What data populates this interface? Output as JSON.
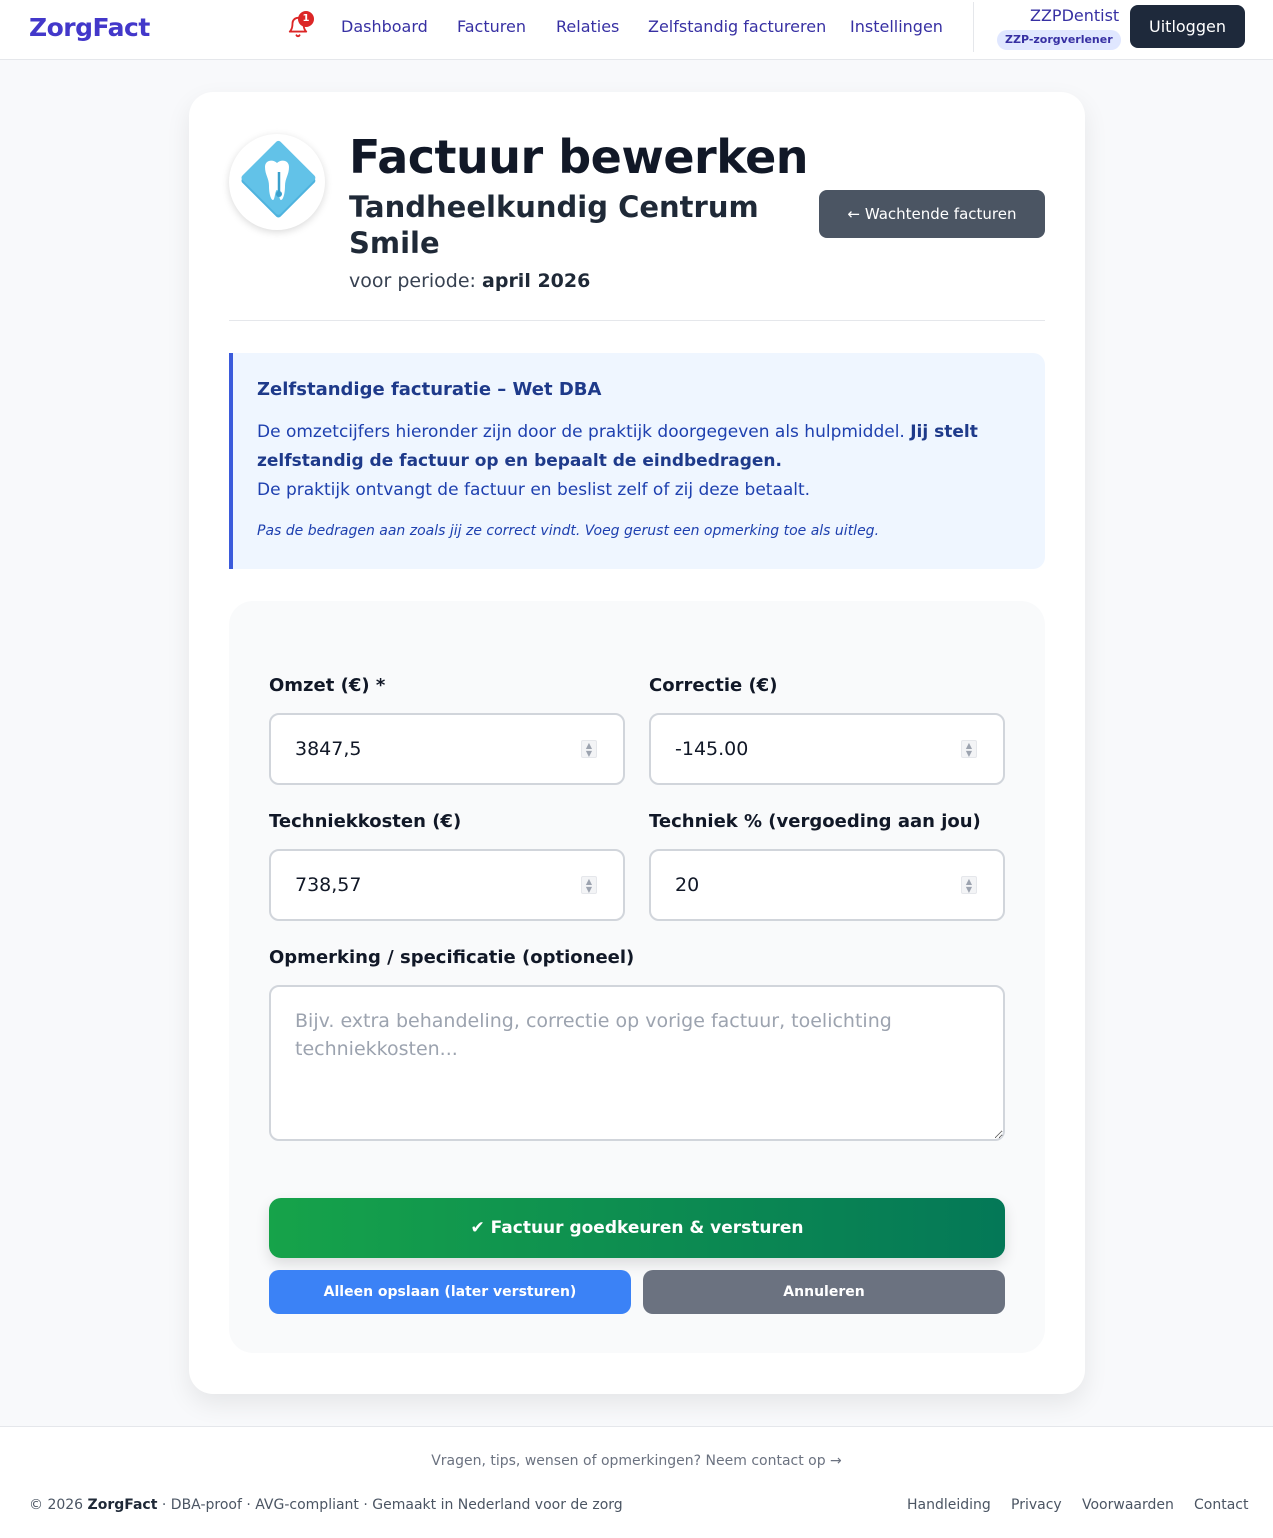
{
  "app": {
    "brand": "ZorgFact",
    "notification_count": "1"
  },
  "nav": {
    "items": [
      {
        "label": "Dashboard"
      },
      {
        "label": "Facturen"
      },
      {
        "label": "Relaties"
      },
      {
        "label": "Zelfstandig factureren"
      },
      {
        "label": "Instellingen"
      }
    ]
  },
  "user": {
    "name": "ZZPDentist",
    "role": "ZZP-zorgverlener",
    "logout_label": "Uitloggen"
  },
  "header": {
    "title": "Factuur bewerken",
    "practice": "Tandheelkundig Centrum Smile",
    "period_prefix": "voor periode:",
    "period_value": "april 2026",
    "back_label": "← Wachtende facturen"
  },
  "info": {
    "title": "Zelfstandige facturatie – Wet DBA",
    "line1": "De omzetcijfers hieronder zijn door de praktijk doorgegeven als hulpmiddel.",
    "line1_bold": "Jij stelt zelfstandig de factuur op en bepaalt de eindbedragen.",
    "line2": "De praktijk ontvangt de factuur en beslist zelf of zij deze betaalt.",
    "note": "Pas de bedragen aan zoals jij ze correct vindt. Voeg gerust een opmerking toe als uitleg."
  },
  "form": {
    "omzet_label": "Omzet (€) *",
    "omzet_value": "3847,5",
    "correctie_label": "Correctie (€)",
    "correctie_value": "-145.00",
    "techniek_label": "Techniekkosten (€)",
    "techniek_value": "738,57",
    "techniek_pct_label": "Techniek % (vergoeding aan jou)",
    "techniek_pct_value": "20",
    "opmerking_label": "Opmerking / specificatie (optioneel)",
    "opmerking_placeholder": "Bijv. extra behandeling, correctie op vorige factuur, toelichting techniekkosten...",
    "approve_label": "✔ Factuur goedkeuren & versturen",
    "save_label": "Alleen opslaan (later versturen)",
    "cancel_label": "Annuleren"
  },
  "footer": {
    "contact": "Vragen, tips, wensen of opmerkingen? Neem contact op →",
    "copy_prefix": "© 2026",
    "copy_brand": "ZorgFact",
    "copy_suffix": "· DBA-proof · AVG-compliant · Gemaakt in Nederland voor de zorg",
    "links": [
      {
        "label": "Handleiding"
      },
      {
        "label": "Privacy"
      },
      {
        "label": "Voorwaarden"
      },
      {
        "label": "Contact"
      }
    ]
  },
  "colors": {
    "brand": "#4338ca",
    "approve_start": "#16a34a",
    "approve_end": "#047857",
    "save": "#3b82f6",
    "cancel": "#6b7280",
    "badge": "#dc2626"
  },
  "icons": {
    "notification": "bell-icon",
    "practice_logo": "tooth-logo-icon",
    "spinner": "number-spinner-icon"
  }
}
